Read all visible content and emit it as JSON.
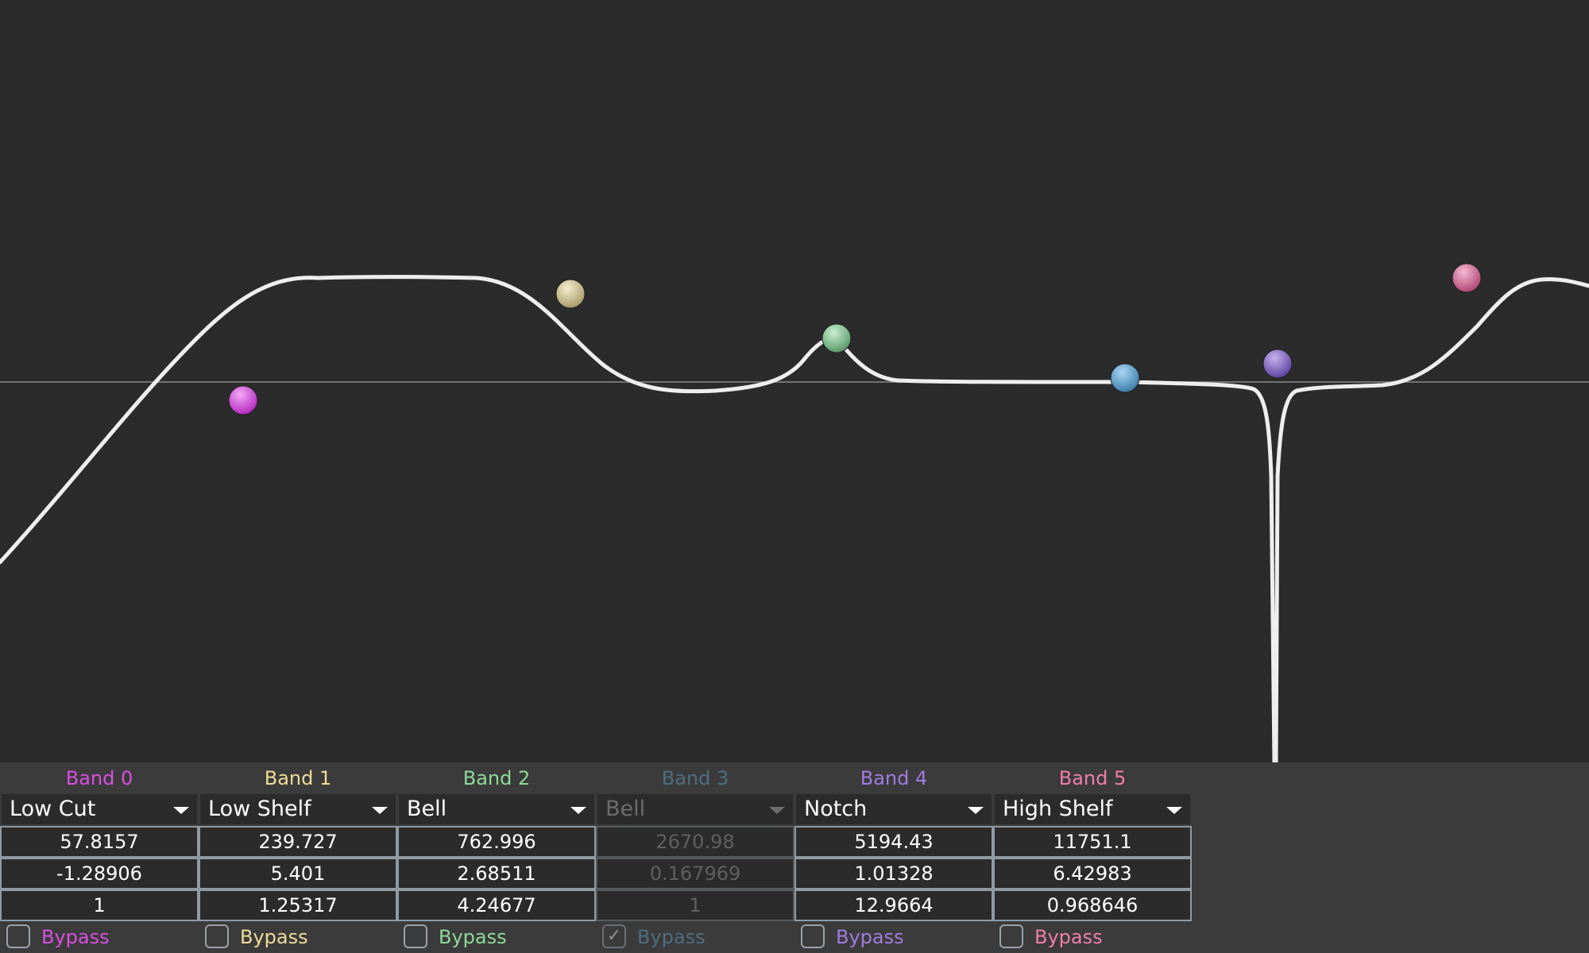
{
  "colors": {
    "background": "#2b2b2b",
    "panel": "#3b3b3b",
    "curve": "#eeeeee",
    "zero_line": "#8a8a8a"
  },
  "graph": {
    "zero_db_line": "0 dB reference line",
    "response_curve": "combined EQ response"
  },
  "bands": [
    {
      "title": "Band 0",
      "type": "Low Cut",
      "freq": "57.8157",
      "gain": "-1.28906",
      "q": "1",
      "bypass_label": "Bypass",
      "bypassed": false,
      "enabled": true,
      "color": "#d94fe0"
    },
    {
      "title": "Band 1",
      "type": "Low Shelf",
      "freq": "239.727",
      "gain": "5.401",
      "q": "1.25317",
      "bypass_label": "Bypass",
      "bypassed": false,
      "enabled": true,
      "color": "#f0dc9a"
    },
    {
      "title": "Band 2",
      "type": "Bell",
      "freq": "762.996",
      "gain": "2.68511",
      "q": "4.24677",
      "bypass_label": "Bypass",
      "bypassed": false,
      "enabled": true,
      "color": "#8fd99a"
    },
    {
      "title": "Band 3",
      "type": "Bell",
      "freq": "2670.98",
      "gain": "0.167969",
      "q": "1",
      "bypass_label": "Bypass",
      "bypassed": true,
      "enabled": false,
      "color": "#4e6d80"
    },
    {
      "title": "Band 4",
      "type": "Notch",
      "freq": "5194.43",
      "gain": "1.01328",
      "q": "12.9664",
      "bypass_label": "Bypass",
      "bypassed": false,
      "enabled": true,
      "color": "#a27be0"
    },
    {
      "title": "Band 5",
      "type": "High Shelf",
      "freq": "11751.1",
      "gain": "6.42983",
      "q": "0.968646",
      "bypass_label": "Bypass",
      "bypassed": false,
      "enabled": true,
      "color": "#ef7fa8"
    }
  ],
  "handle_colors": [
    "#c443cc",
    "#d8cfa0",
    "#88c79a",
    "#5aa3d3",
    "#8a68c9",
    "#d9719a"
  ]
}
